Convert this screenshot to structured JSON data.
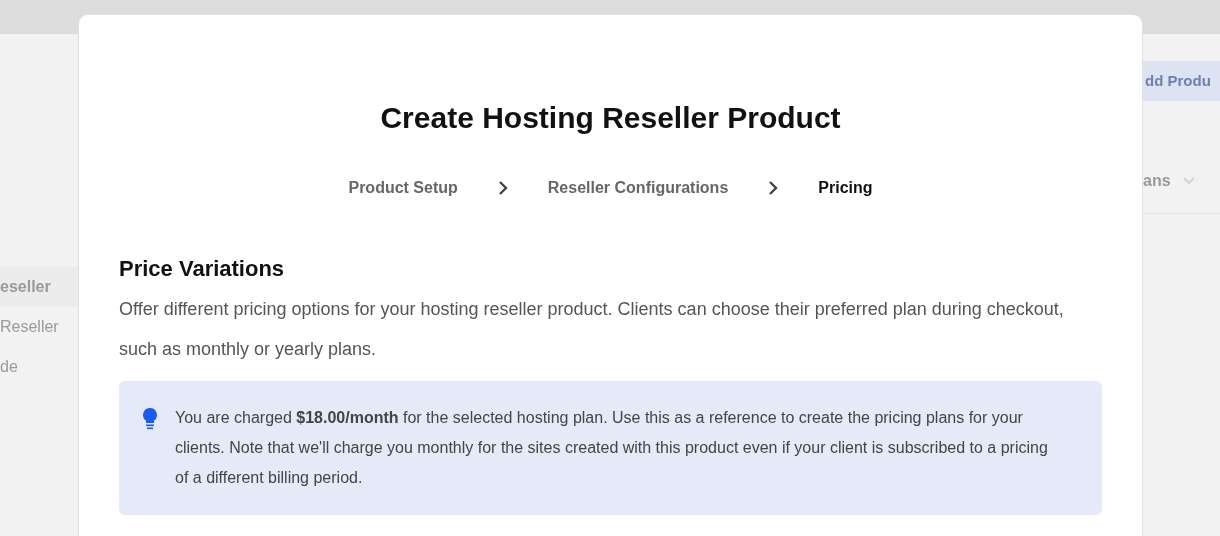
{
  "background": {
    "sidebar_items": [
      {
        "label": "eseller",
        "selected": true
      },
      {
        "label": "Reseller",
        "selected": false
      },
      {
        "label": "de",
        "selected": false
      }
    ],
    "add_button": "dd Produ",
    "filter": "ans"
  },
  "modal": {
    "title": "Create Hosting Reseller Product",
    "steps": [
      {
        "label": "Product Setup",
        "selected": false
      },
      {
        "label": "Reseller Configurations",
        "selected": false
      },
      {
        "label": "Pricing",
        "selected": true
      }
    ],
    "section_title": "Price Variations",
    "description": "Offer different pricing options for your hosting reseller product. Clients can choose their preferred plan during checkout, such as monthly or yearly plans.",
    "notice": "You are charged **$18.00/month** for the selected hosting plan. Use this as a reference to create the pricing plans for your clients. Note that we'll charge you monthly for the sites created with this product even if your client is subscribed to a pricing of a different billing period."
  }
}
